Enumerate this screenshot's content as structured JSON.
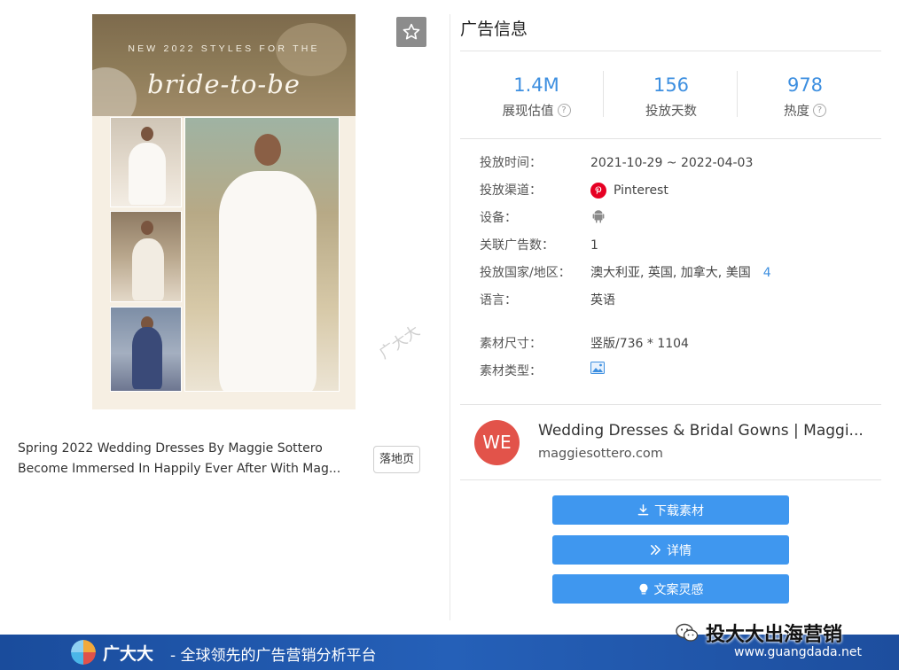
{
  "creative": {
    "kicker": "NEW 2022 STYLES FOR THE",
    "headline": "bride-to-be",
    "watermark": "广大大"
  },
  "favorite": {
    "icon": "star-outline-icon"
  },
  "ad_text": {
    "line1": "Spring 2022 Wedding Dresses By Maggie Sottero",
    "line2": "Become Immersed In Happily Ever After With Mag..."
  },
  "landing_button": "落地页",
  "panel": {
    "title": "广告信息"
  },
  "stats": [
    {
      "value": "1.4M",
      "label": "展现估值",
      "help": true
    },
    {
      "value": "156",
      "label": "投放天数",
      "help": false
    },
    {
      "value": "978",
      "label": "热度",
      "help": true
    }
  ],
  "details": {
    "time_label": "投放时间：",
    "time_value": "2021-10-29 ~ 2022-04-03",
    "channel_label": "投放渠道：",
    "channel_value": "Pinterest",
    "channel_icon": "pinterest-icon",
    "device_label": "设备：",
    "device_icon": "android-icon",
    "related_label": "关联广告数：",
    "related_value": "1",
    "country_label": "投放国家/地区：",
    "country_value": "澳大利亚, 英国, 加拿大, 美国",
    "country_more": "4",
    "language_label": "语言：",
    "language_value": "英语",
    "size_label": "素材尺寸：",
    "size_value": "竖版/736 * 1104",
    "type_label": "素材类型：",
    "type_icon": "image-icon"
  },
  "advertiser": {
    "initials": "WE",
    "name": "Wedding Dresses & Bridal Gowns | Maggi...",
    "domain": "maggiesottero.com",
    "avatar_color": "#e2534a"
  },
  "actions": {
    "download": "下载素材",
    "details": "详情",
    "copy_inspiration": "文案灵感"
  },
  "footer": {
    "wechat_account": "投大大出海营销",
    "brand": "广大大",
    "slogan": "- 全球领先的广告营销分析平台",
    "url": "www.guangdada.net"
  },
  "colors": {
    "accent": "#3f97ef",
    "stat_value": "#3d8fe0",
    "banner": "#1f55a8"
  }
}
